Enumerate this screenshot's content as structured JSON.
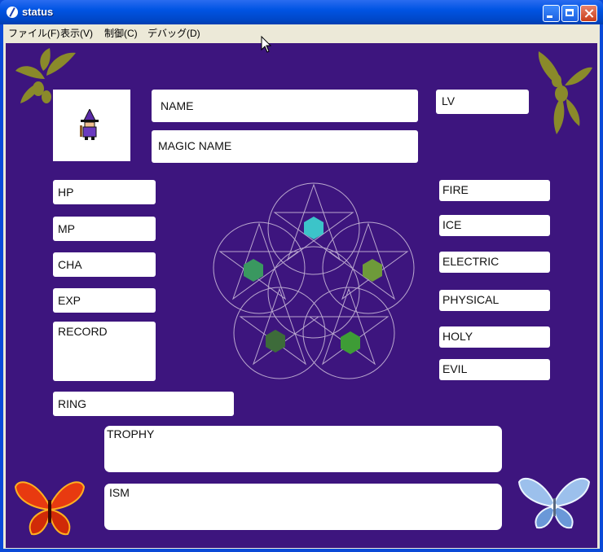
{
  "window": {
    "title": "status"
  },
  "menu": [
    "ファイル(F)",
    "表示(V)",
    "制御(C)",
    "デバッグ(D)"
  ],
  "fields": {
    "name": "NAME",
    "magic_name": "MAGIC NAME",
    "lv": "LV",
    "hp": "HP",
    "mp": "MP",
    "cha": "CHA",
    "exp": "EXP",
    "record": "RECORD",
    "ring": "RING",
    "trophy": "TROPHY",
    "ism": "ISM"
  },
  "elements": [
    "FIRE",
    "ICE",
    "ELECTRIC",
    "PHYSICAL",
    "HOLY",
    "EVIL"
  ],
  "colors": {
    "panel_bg": "#3d157e",
    "gem_top": "#3cc4c9",
    "gem_left": "#3a9860",
    "gem_right": "#6e9a3a",
    "gem_bottom_left": "#3d6b3a",
    "gem_bottom_right": "#3e9c36"
  }
}
